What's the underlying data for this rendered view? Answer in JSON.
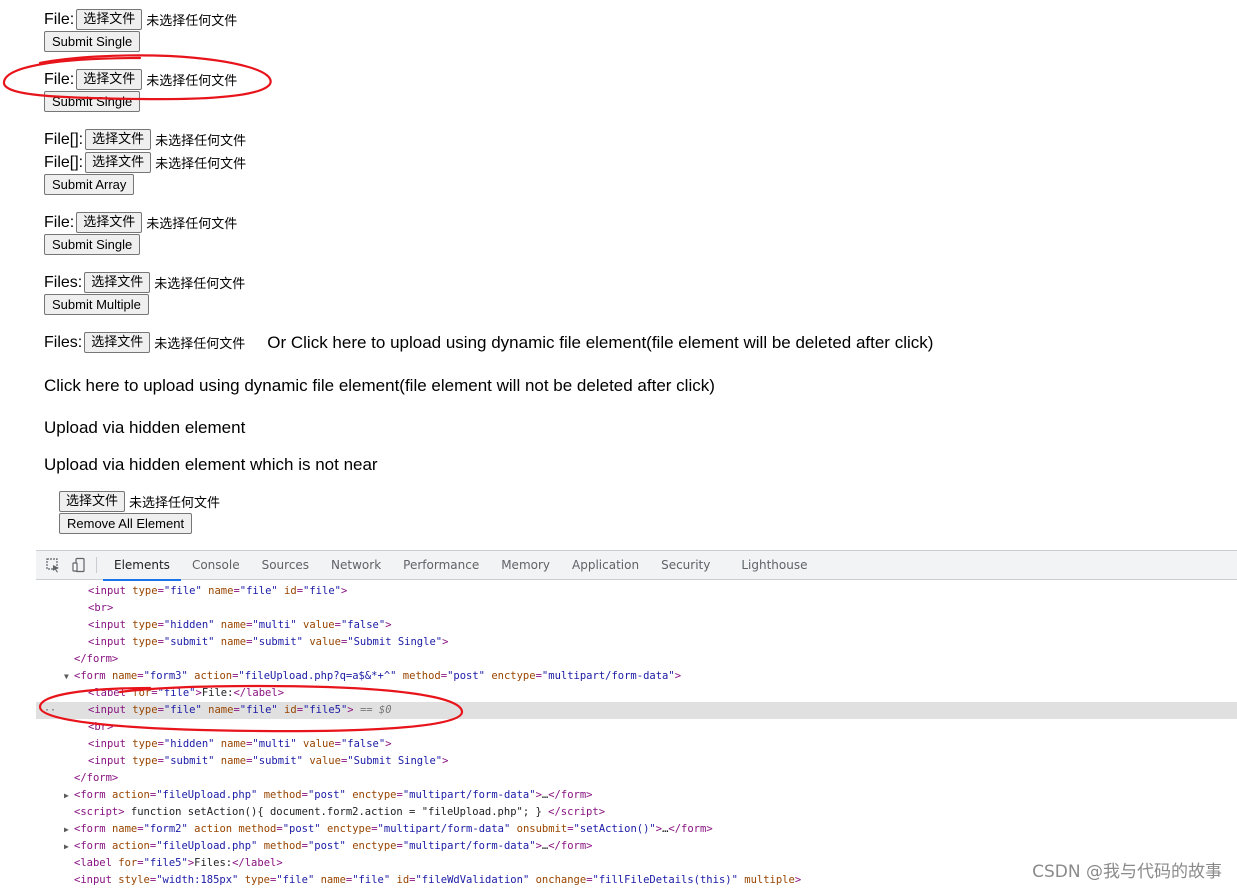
{
  "file_input": {
    "button": "选择文件",
    "status": "未选择任何文件"
  },
  "forms": {
    "f1": {
      "label": "File:",
      "submit": "Submit Single"
    },
    "f2": {
      "label": "File:",
      "submit": "Submit Single"
    },
    "f3": {
      "label1": "File[]:",
      "label2": "File[]:",
      "submit": "Submit Array"
    },
    "f4": {
      "label": "File:",
      "submit": "Submit Single"
    },
    "f5": {
      "label": "Files:",
      "submit": "Submit Multiple"
    },
    "f6": {
      "label": "Files:",
      "link": "Or Click here to upload using dynamic file element(file element will be deleted after click)"
    }
  },
  "links": {
    "dynamic_not_deleted": "Click here to upload using dynamic file element(file element will not be deleted after click)",
    "hidden": "Upload via hidden element",
    "hidden_not_near": "Upload via hidden element which is not near"
  },
  "remove_button": "Remove All Element",
  "devtools": {
    "tabs": [
      "Elements",
      "Console",
      "Sources",
      "Network",
      "Performance",
      "Memory",
      "Application",
      "Security",
      "Lighthouse"
    ],
    "active_tab": "Elements",
    "selected_suffix": " == $0"
  },
  "watermark": "CSDN @我与代码的故事",
  "colors": {
    "annotation": "#e8141b",
    "tab_underline": "#1a73e8",
    "selected_row": "#e0e0e0"
  }
}
